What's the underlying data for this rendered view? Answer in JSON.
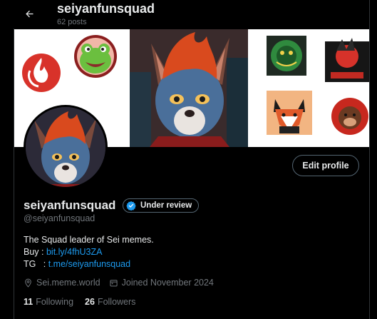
{
  "header": {
    "back_icon": "arrow-left-icon",
    "title": "seiyanfunsquad",
    "posts_count": "62 posts"
  },
  "profile": {
    "display_name": "seiyanfunsquad",
    "badge_label": "Under review",
    "badge_icon": "verified-check-icon",
    "handle": "@seiyanfunsquad",
    "edit_button": "Edit profile",
    "bio": {
      "line1": "The Squad leader of Sei memes.",
      "buy_label": "Buy : ",
      "buy_link": "bit.ly/4fhU3ZA",
      "tg_label": "TG   : ",
      "tg_link": "t.me/seiyanfunsquad"
    },
    "location": "Sei.meme.world",
    "joined": "Joined November 2024",
    "following_count": "11",
    "following_label": "Following",
    "followers_count": "26",
    "followers_label": "Followers"
  },
  "banner": {
    "stickers": [
      "fire-logo",
      "frog-face",
      "dragon-sticker",
      "fox-sticker",
      "seiyan-logo",
      "monkey-sticker"
    ]
  },
  "colors": {
    "background": "#000000",
    "text_primary": "#e7e9ea",
    "text_secondary": "#71767b",
    "link": "#1d9bf0",
    "border": "#536471"
  }
}
